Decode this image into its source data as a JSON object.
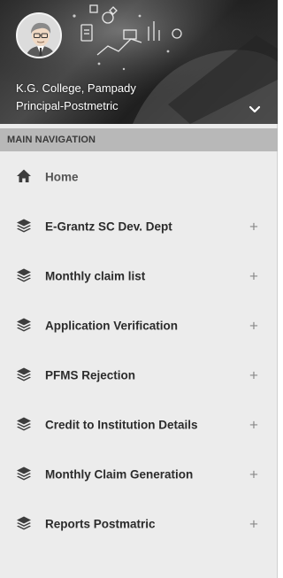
{
  "profile": {
    "name": "K.G. College, Pampady",
    "role": "Principal-Postmetric"
  },
  "nav_header": "MAIN NAVIGATION",
  "menu": [
    {
      "label": "Home",
      "icon": "home-icon",
      "expandable": false
    },
    {
      "label": "E-Grantz SC Dev. Dept",
      "icon": "layers-icon",
      "expandable": true,
      "expand_symbol": "+"
    },
    {
      "label": "Monthly claim list",
      "icon": "layers-icon",
      "expandable": true,
      "expand_symbol": "+"
    },
    {
      "label": "Application Verification",
      "icon": "layers-icon",
      "expandable": true,
      "expand_symbol": "+"
    },
    {
      "label": "PFMS Rejection",
      "icon": "layers-icon",
      "expandable": true,
      "expand_symbol": "+"
    },
    {
      "label": "Credit to Institution Details",
      "icon": "layers-icon",
      "expandable": true,
      "expand_symbol": "+"
    },
    {
      "label": "Monthly Claim Generation",
      "icon": "layers-icon",
      "expandable": true,
      "expand_symbol": "+"
    },
    {
      "label": "Reports Postmatric",
      "icon": "layers-icon",
      "expandable": true,
      "expand_symbol": "+"
    }
  ],
  "colors": {
    "sidebar_bg": "#ececec",
    "nav_header_bg": "#b8b8b8",
    "menu_text": "#2b2b2b",
    "plus_color": "#8a8a8a"
  }
}
